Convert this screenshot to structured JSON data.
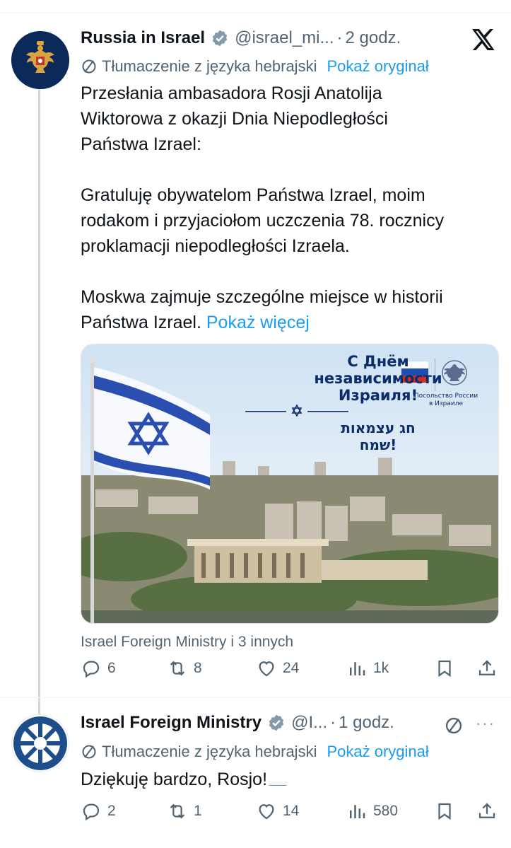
{
  "post1": {
    "author_name": "Russia in Israel",
    "handle": "@israel_mi...",
    "dot": "·",
    "time": "2 godz.",
    "translation_note": "Tłumaczenie z języka hebrajski",
    "show_original": "Pokaż oryginał",
    "paragraphs": [
      [
        "Przesłania ambasadora Rosji Anatolija",
        "Wiktorowa z okazji Dnia Niepodległości",
        "Państwa Izrael:"
      ],
      [
        "Gratuluję obywatelom Państwa Izrael, moim",
        "rodakom i przyjaciołom uczczenia 78. rocznicy",
        "proklamacji niepodległości Izraela."
      ],
      [
        "Moskwa zajmuje szczególne miejsce w historii"
      ]
    ],
    "last_line": "Państwa Izrael.",
    "show_more": "Pokaż więcej",
    "image": {
      "title_line1": "С Днём",
      "title_line2": "независимости",
      "title_line3": "Израиля!",
      "hebrew_line1": "חג עצמאות",
      "hebrew_line2": "שמח!",
      "embassy_line1": "Посольство России",
      "embassy_line2": "в Израиле"
    },
    "replied_by": "Israel Foreign Ministry i 3 innych",
    "stats": {
      "replies": "6",
      "reposts": "8",
      "likes": "24",
      "views": "1k"
    }
  },
  "post2": {
    "author_name": "Israel Foreign Ministry",
    "handle": "@I...",
    "dot": "·",
    "time": "1 godz.",
    "translation_note": "Tłumaczenie z języka hebrajski",
    "show_original": "Pokaż oryginał",
    "text": "Dziękuję bardzo, Rosjo!",
    "more_menu": "···",
    "stats": {
      "replies": "2",
      "reposts": "1",
      "likes": "14",
      "views": "580"
    }
  },
  "colors": {
    "accent": "#1d9bf0",
    "secondary_text": "#536471",
    "verified_badge": "#829aab"
  },
  "icons": {
    "reply": "reply-icon",
    "repost": "repost-icon",
    "like": "heart-icon",
    "views": "views-icon",
    "bookmark": "bookmark-icon",
    "share": "share-icon"
  }
}
